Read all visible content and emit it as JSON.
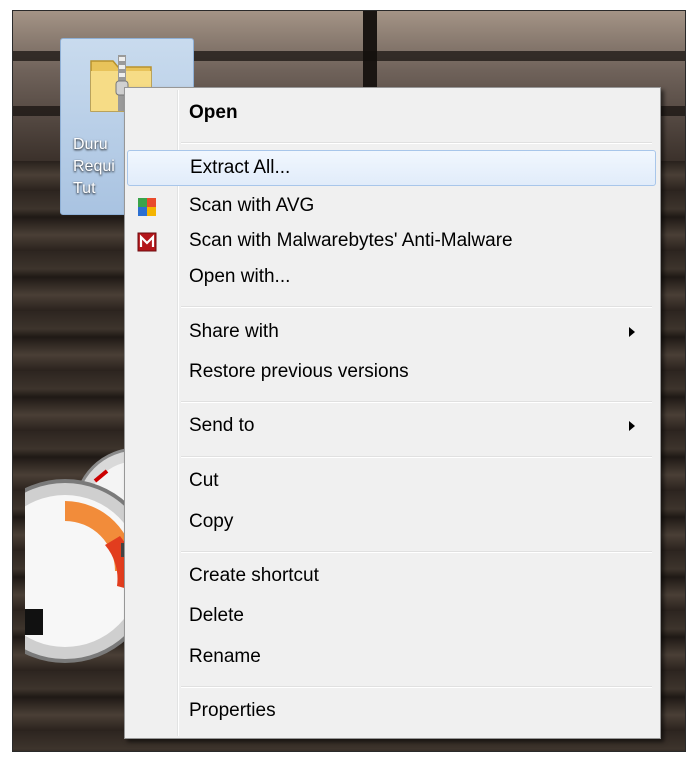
{
  "desktop": {
    "icon": {
      "name": "zip-folder-icon",
      "label_lines": [
        "Duru",
        "Requi",
        "Tut"
      ]
    }
  },
  "context_menu": {
    "items": [
      {
        "label": "Open",
        "bold": true
      },
      {
        "label": "Extract All...",
        "highlighted": true
      },
      {
        "label": "Scan with AVG",
        "icon": "avg-icon"
      },
      {
        "label": "Scan with Malwarebytes' Anti-Malware",
        "icon": "malwarebytes-icon"
      },
      {
        "label": "Open with..."
      },
      {
        "label": "Share with",
        "submenu": true
      },
      {
        "label": "Restore previous versions"
      },
      {
        "label": "Send to",
        "submenu": true
      },
      {
        "label": "Cut"
      },
      {
        "label": "Copy"
      },
      {
        "label": "Create shortcut"
      },
      {
        "label": "Delete"
      },
      {
        "label": "Rename"
      },
      {
        "label": "Properties"
      }
    ],
    "colors": {
      "highlight_border": "#a8c6ea",
      "background": "#f0f0f0"
    }
  }
}
